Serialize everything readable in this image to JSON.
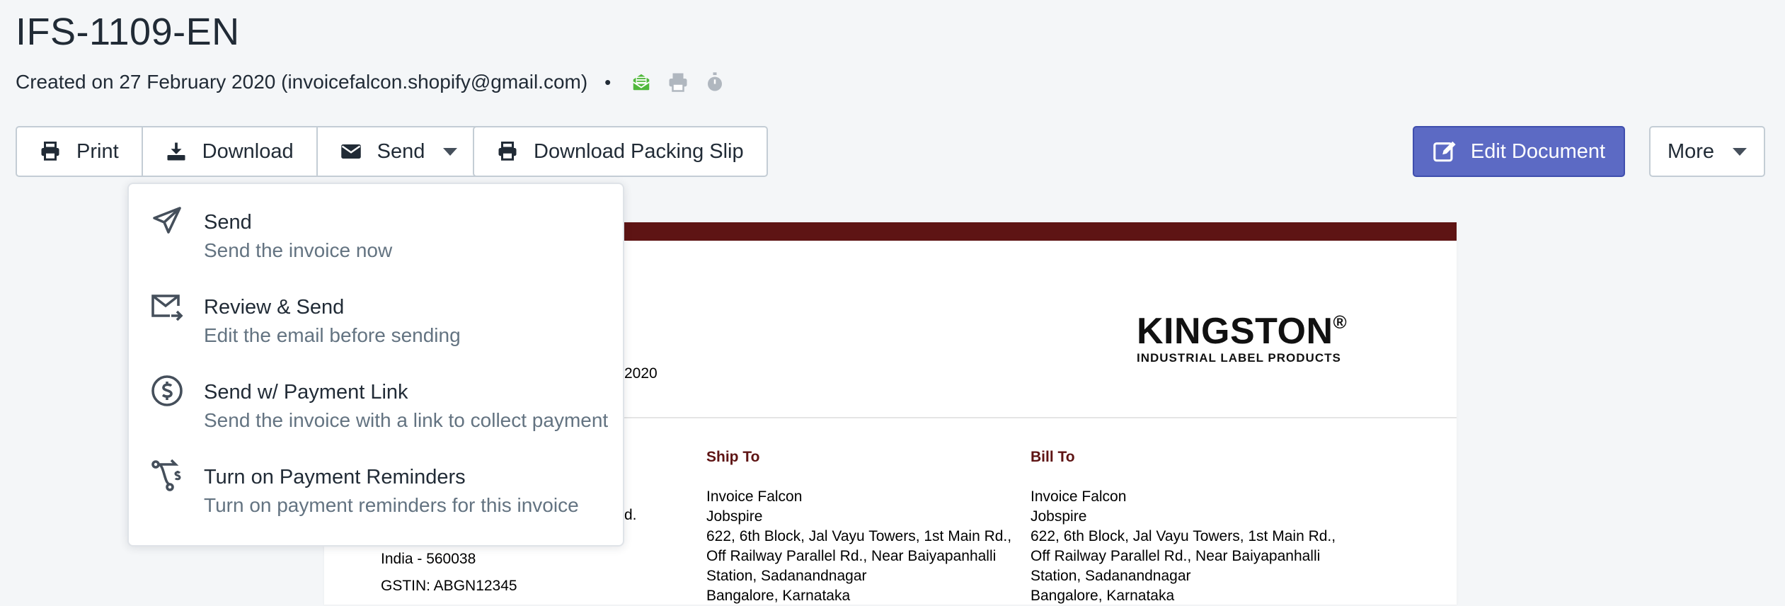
{
  "header": {
    "title": "IFS-1109-EN",
    "created": "Created on 27 February 2020 (invoicefalcon.shopify@gmail.com)",
    "separator": "•",
    "status_icons": [
      "email-sent-icon",
      "printer-icon",
      "timer-icon"
    ]
  },
  "toolbar": {
    "print_label": "Print",
    "download_label": "Download",
    "send_label": "Send",
    "packing_slip_label": "Download Packing Slip",
    "edit_label": "Edit Document",
    "more_label": "More"
  },
  "send_menu": {
    "items": [
      {
        "title": "Send",
        "subtitle": "Send the invoice now",
        "icon": "paper-plane-icon"
      },
      {
        "title": "Review & Send",
        "subtitle": "Edit the email before sending",
        "icon": "envelope-arrow-icon"
      },
      {
        "title": "Send w/ Payment Link",
        "subtitle": "Send the invoice with a link to collect payment",
        "icon": "dollar-circle-icon"
      },
      {
        "title": "Turn on Payment Reminders",
        "subtitle": "Turn on payment reminders for this invoice",
        "icon": "payment-reminder-icon"
      }
    ]
  },
  "document": {
    "date_fragment": "2020",
    "logo_text": "KINGSTON",
    "logo_reg": "®",
    "logo_sub": "INDUSTRIAL LABEL PRODUCTS",
    "left_frag": "d.",
    "left_lines": [
      "India - 560038",
      "GSTIN: ABGN12345"
    ],
    "ship_to": {
      "heading": "Ship To",
      "lines": [
        "Invoice Falcon",
        "Jobspire",
        "622, 6th Block, Jal Vayu Towers, 1st Main Rd.,",
        "Off Railway Parallel Rd., Near Baiyapanhalli",
        "Station, Sadanandnagar",
        "Bangalore, Karnataka"
      ]
    },
    "bill_to": {
      "heading": "Bill To",
      "lines": [
        "Invoice Falcon",
        "Jobspire",
        "622, 6th Block, Jal Vayu Towers, 1st Main Rd.,",
        "Off Railway Parallel Rd., Near Baiyapanhalli",
        "Station, Sadanandnagar",
        "Bangalore, Karnataka"
      ]
    }
  },
  "colors": {
    "primary": "#5c6ac4",
    "brand_dark_red": "#5e1414",
    "sent_green": "#50b83c"
  }
}
